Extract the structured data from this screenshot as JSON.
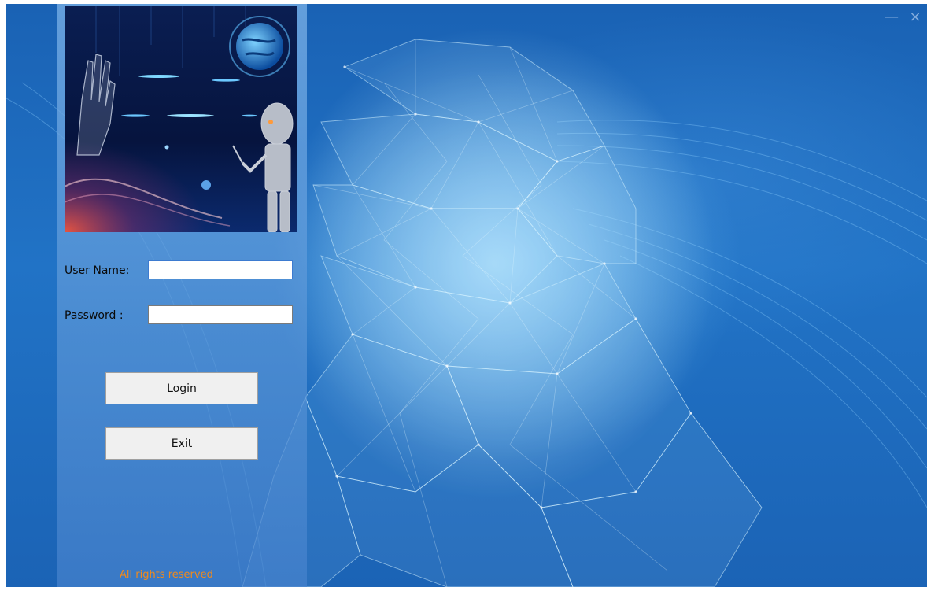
{
  "window": {
    "controls": {
      "minimize": "—",
      "close": "×"
    }
  },
  "banner": {
    "description_icon": "robot-hand-globe-icon"
  },
  "form": {
    "username_label": "User Name:",
    "username_value": "",
    "password_label": "Password :",
    "password_value": ""
  },
  "buttons": {
    "login": "Login",
    "exit": "Exit"
  },
  "footer": {
    "copyright": "All rights reserved"
  },
  "colors": {
    "background": "#1f6ec0",
    "panel": "#6fa6dd",
    "footer_text": "#f08a1c",
    "button_bg": "#f0f0f0"
  }
}
